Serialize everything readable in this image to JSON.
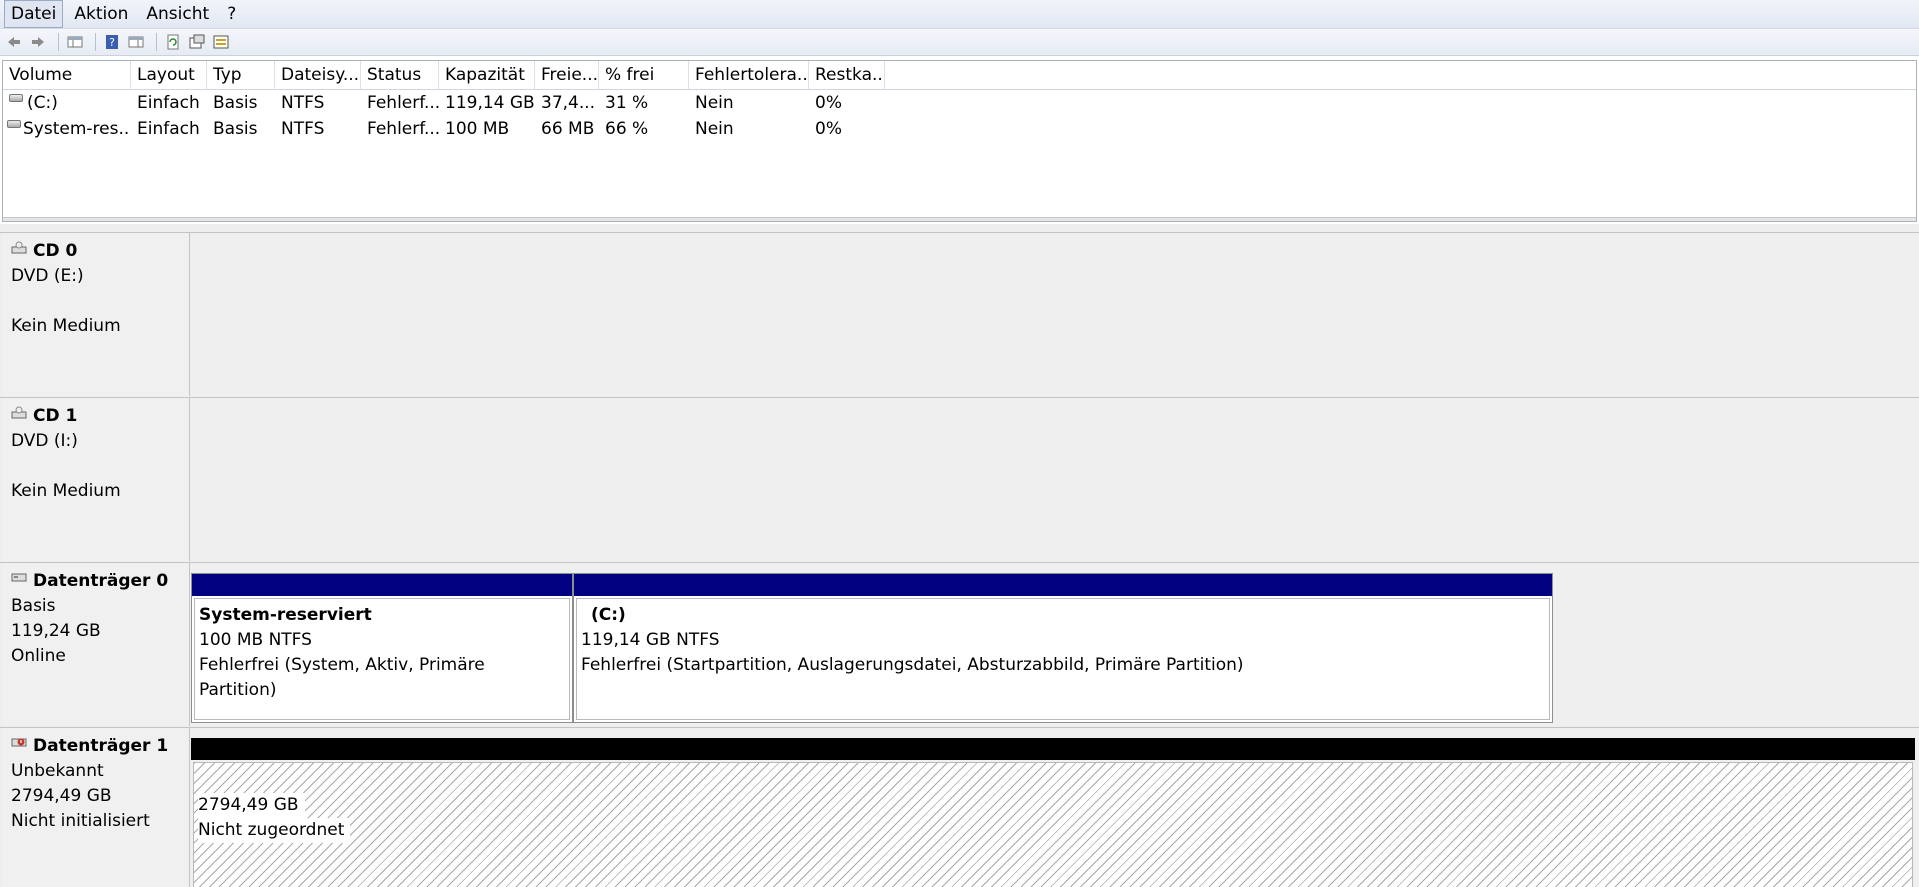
{
  "menu": {
    "items": [
      "Datei",
      "Aktion",
      "Ansicht",
      "?"
    ]
  },
  "toolbar": {
    "buttons": [
      "back-icon",
      "forward-icon",
      "show-hide-console-tree-icon",
      "help-icon",
      "properties-pane-icon",
      "refresh-icon",
      "properties-icon",
      "rescan-icon"
    ]
  },
  "volume_list": {
    "columns": [
      "Volume",
      "Layout",
      "Typ",
      "Dateisy...",
      "Status",
      "Kapazität",
      "Freie...",
      "% frei",
      "Fehlertolera...",
      "Restka..."
    ],
    "rows": [
      [
        "(C:)",
        "Einfach",
        "Basis",
        "NTFS",
        "Fehlerf...",
        "119,14 GB",
        "37,4...",
        "31 %",
        "Nein",
        "0%"
      ],
      [
        "System-res...",
        "Einfach",
        "Basis",
        "NTFS",
        "Fehlerf...",
        "100 MB",
        "66 MB",
        "66 %",
        "Nein",
        "0%"
      ]
    ]
  },
  "disks": {
    "cd0": {
      "name": "CD 0",
      "line1": "DVD (E:)",
      "line2": "",
      "line3": "Kein Medium"
    },
    "cd1": {
      "name": "CD 1",
      "line1": "DVD (I:)",
      "line2": "",
      "line3": "Kein Medium"
    },
    "disk0": {
      "name": "Datenträger 0",
      "line1": "Basis",
      "line2": "119,24 GB",
      "line3": "Online",
      "partitions": [
        {
          "title": "System-reserviert",
          "size": "100 MB NTFS",
          "status": "Fehlerfrei (System, Aktiv, Primäre Partition)"
        },
        {
          "title": "(C:)",
          "size": "119,14 GB NTFS",
          "status": "Fehlerfrei (Startpartition, Auslagerungsdatei, Absturzabbild, Primäre Partition)"
        }
      ]
    },
    "disk1": {
      "name": "Datenträger 1",
      "line1": "Unbekannt",
      "line2": "2794,49 GB",
      "line3": "Nicht initialisiert",
      "unallocated": {
        "size": "2794,49 GB",
        "label": "Nicht zugeordnet"
      }
    }
  },
  "colors": {
    "primary_partition_bar": "#000080",
    "unallocated_bar": "#000000"
  }
}
